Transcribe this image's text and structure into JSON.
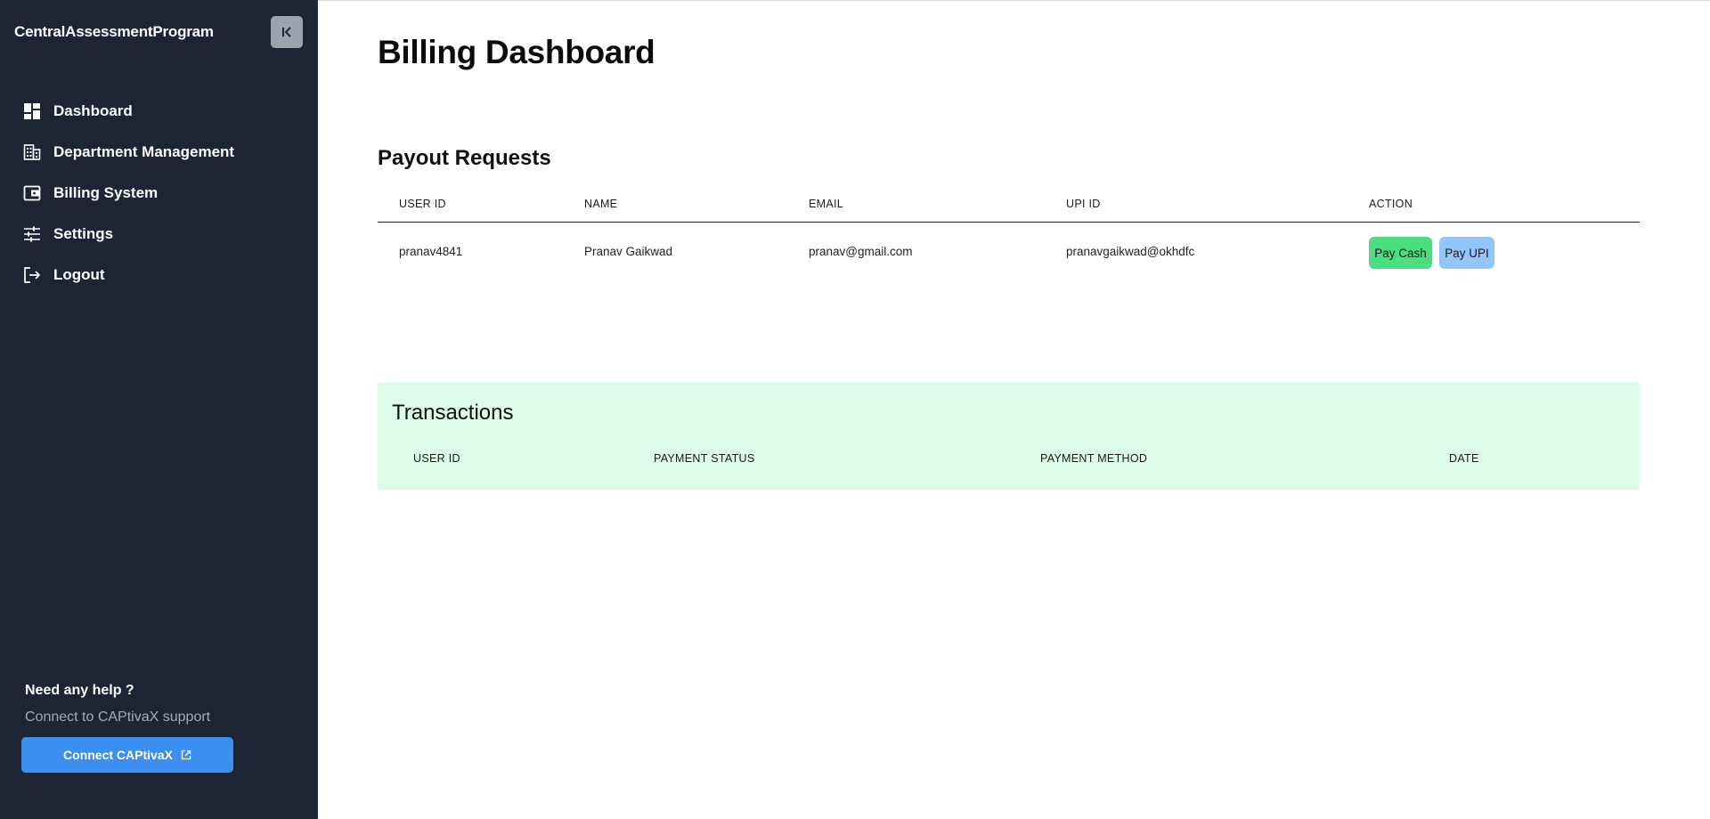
{
  "sidebar": {
    "brand": "CentralAssessmentProgram",
    "items": [
      {
        "label": "Dashboard",
        "icon": "dashboard-icon"
      },
      {
        "label": "Department Management",
        "icon": "building-icon"
      },
      {
        "label": "Billing System",
        "icon": "wallet-icon"
      },
      {
        "label": "Settings",
        "icon": "sliders-icon"
      },
      {
        "label": "Logout",
        "icon": "logout-icon"
      }
    ],
    "help_title": "Need any help ?",
    "help_subtitle": "Connect to CAPtivaX support",
    "connect_label": "Connect CAPtivaX"
  },
  "main": {
    "title": "Billing Dashboard",
    "payout": {
      "title": "Payout Requests",
      "headers": [
        "USER ID",
        "NAME",
        "EMAIL",
        "UPI ID",
        "ACTION"
      ],
      "rows": [
        {
          "user_id": "pranav4841",
          "name": "Pranav Gaikwad",
          "email": "pranav@gmail.com",
          "upi_id": "pranavgaikwad@okhdfc",
          "pay_cash": "Pay Cash",
          "pay_upi": "Pay UPI"
        }
      ]
    },
    "transactions": {
      "title": "Transactions",
      "headers": [
        "USER ID",
        "PAYMENT STATUS",
        "PAYMENT METHOD",
        "DATE"
      ]
    }
  },
  "colors": {
    "sidebar_bg": "#1d2435",
    "accent_blue": "#3b8ff0",
    "pay_cash_bg": "#4ade80",
    "pay_upi_bg": "#93c5fd",
    "transactions_bg": "#dcfce7"
  }
}
